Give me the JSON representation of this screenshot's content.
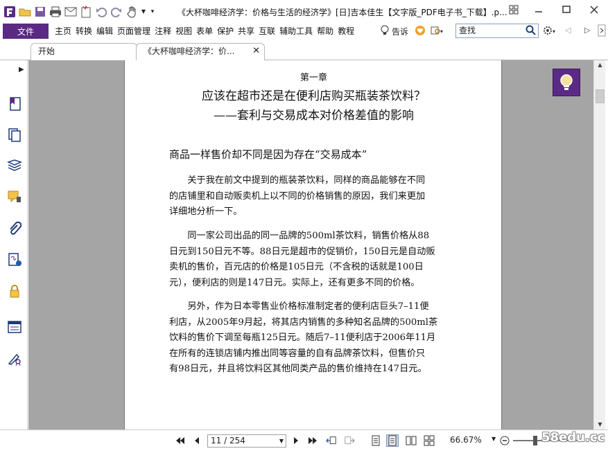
{
  "window": {
    "title": "《大杯咖啡经济学：价格与生活的经济学》[日]吉本佳生【文字版_PDF电子书_下载】.p..."
  },
  "menu": {
    "file": "文件",
    "items": [
      "主页",
      "转换",
      "编辑",
      "页面管理",
      "注释",
      "视图",
      "表单",
      "保护",
      "共享",
      "互联",
      "辅助工具",
      "帮助",
      "教程"
    ],
    "tell_me": "告诉",
    "search_placeholder": "查找"
  },
  "tabs": [
    {
      "label": "开始"
    },
    {
      "label": "《大杯咖啡经济学：价..."
    }
  ],
  "document": {
    "chapter": "第一章",
    "title_line1": "应该在超市还是在便利店购买瓶装茶饮料？",
    "title_line2": "——套利与交易成本对价格差值的影响",
    "section_heading": "商品一样售价却不同是因为存在“交易成本”",
    "paragraphs": [
      [
        "　　关于我在前文中提到的瓶装茶饮料，同样的商品能够在不同",
        "的店铺里和自动贩卖机上以不同的价格销售的原因，我们来更加",
        "详细地分析一下。"
      ],
      [
        "　　同一家公司出品的同一品牌的500ml茶饮料，销售价格从88",
        "日元到150日元不等。88日元是超市的促销价，150日元是自动贩",
        "卖机的售价，百元店的价格是105日元（不含税的话就是100日",
        "元），便利店的则是147日元。实际上，还有更多不同的价格。"
      ],
      [
        "　　另外，作为日本零售业价格标准制定者的便利店巨头7–11便",
        "利店，从2005年9月起，将其店内销售的多种知名品牌的500ml茶",
        "饮料的售价下调至每瓶125日元。随后7–11便利店于2006年11月",
        "在所有的连锁店铺内推出同等容量的自有品牌茶饮料，但售价只",
        "有98日元，并且将饮料区其他同类产品的售价维持在147日元。"
      ]
    ]
  },
  "statusbar": {
    "page_display": "11 / 254",
    "zoom": "66.67%",
    "watermark": "58edu.cc"
  },
  "colors": {
    "accent": "#5a2a84",
    "doc_background": "#a5a5a5"
  }
}
